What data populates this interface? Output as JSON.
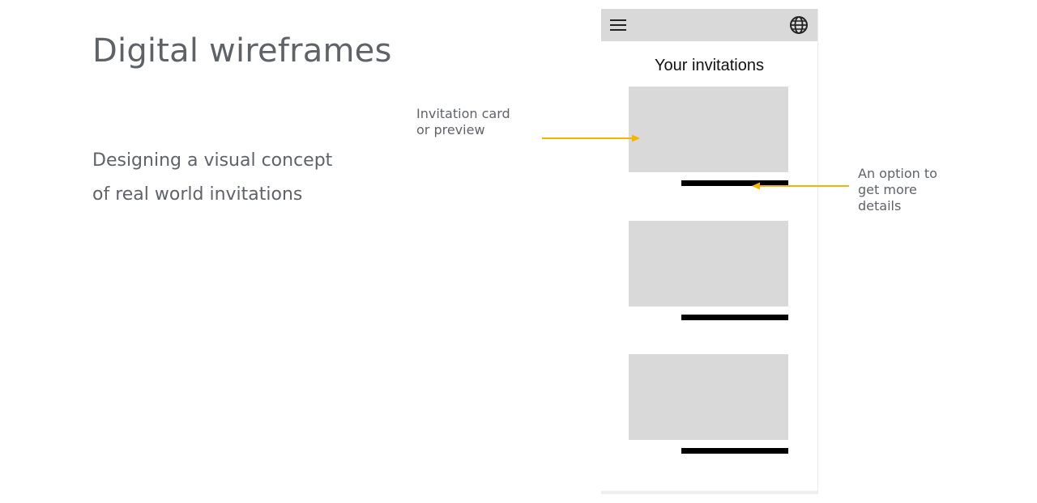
{
  "slide": {
    "title": "Digital wireframes",
    "body_line1": "Designing a visual concept",
    "body_line2": "of real world invitations"
  },
  "annotations": {
    "left_line1": "Invitation card",
    "left_line2": "or preview",
    "right_line1": "An option to",
    "right_line2": "get more",
    "right_line3": "details"
  },
  "phone": {
    "header_icons": [
      "menu-icon",
      "globe-icon"
    ],
    "title": "Your invitations",
    "cards": [
      {
        "kind": "invitation-card"
      },
      {
        "kind": "invitation-card"
      },
      {
        "kind": "invitation-card"
      }
    ]
  },
  "colors": {
    "text_gray": "#5f6368",
    "placeholder_gray": "#d9d9d9",
    "arrow_yellow": "#f4b400",
    "bar_black": "#000000"
  }
}
